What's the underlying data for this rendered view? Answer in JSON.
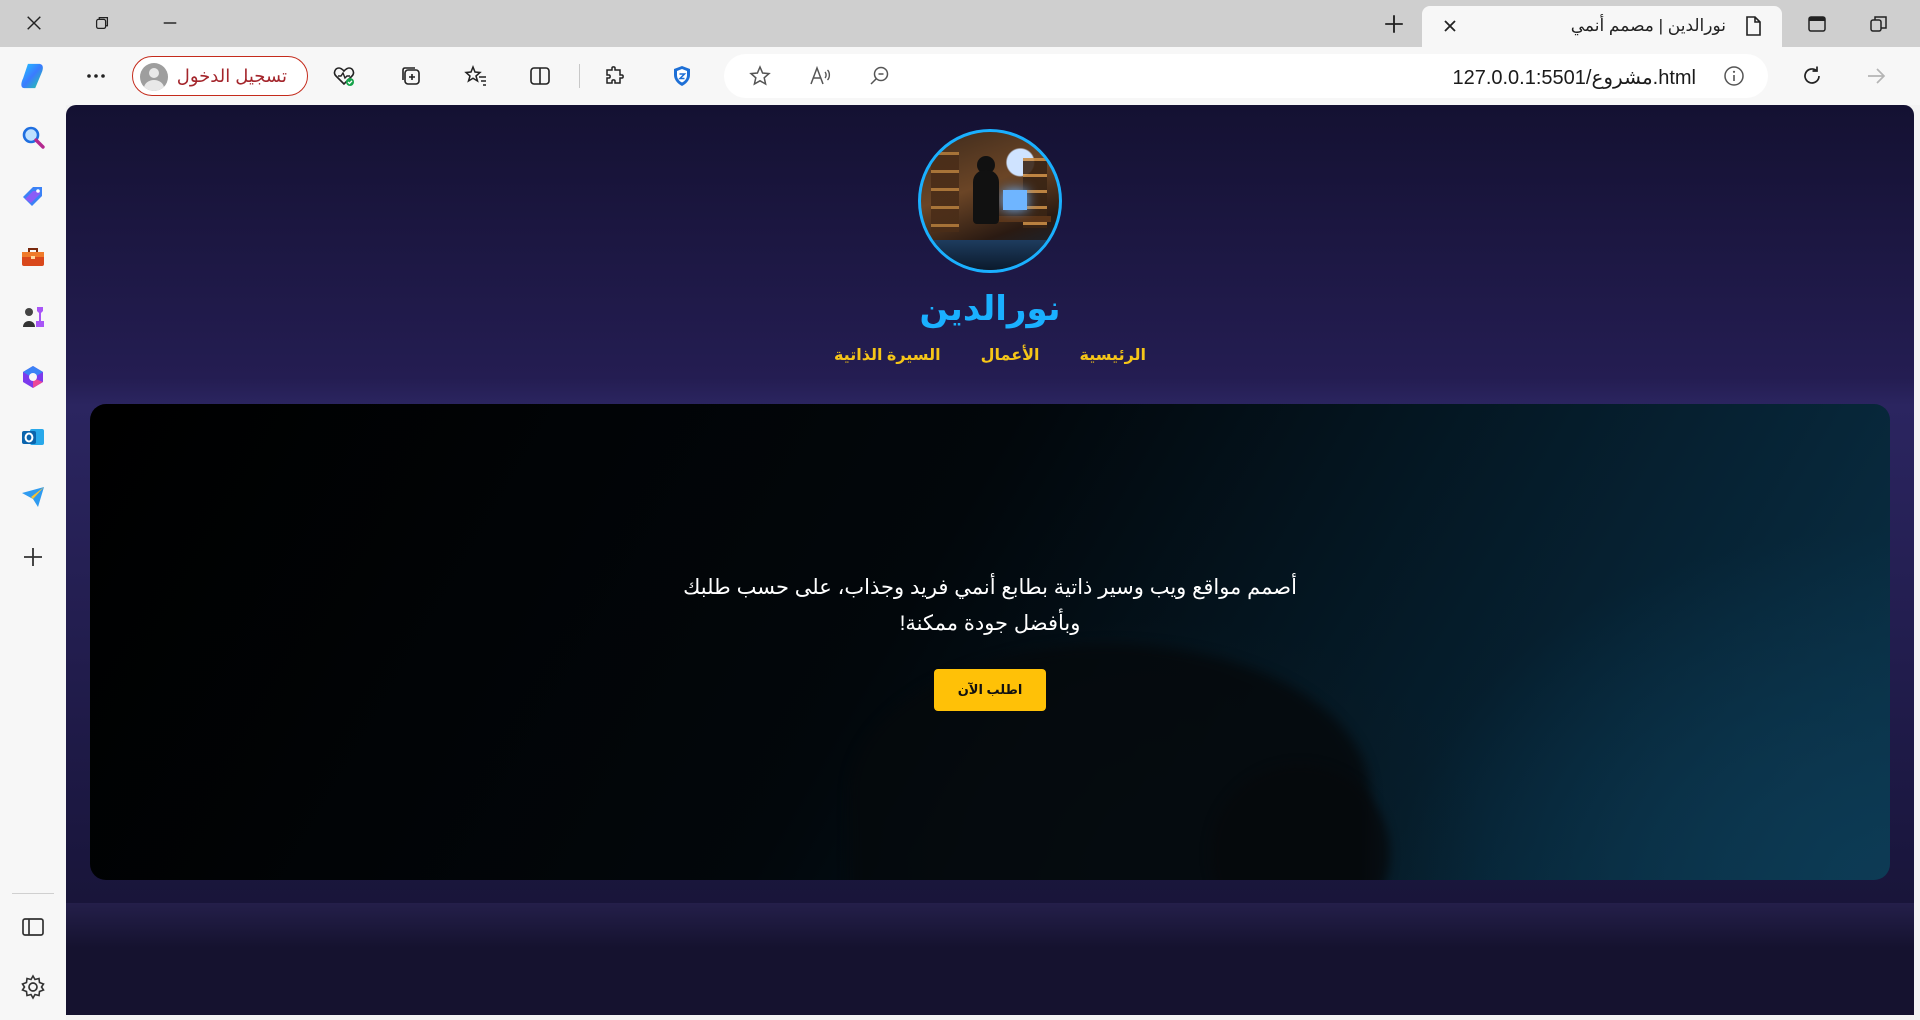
{
  "browser": {
    "tab": {
      "title": "نورالدين | مصمم أنمي",
      "favicon": "page-icon"
    },
    "window_controls": [
      "close-icon",
      "restore-icon",
      "minimize-icon"
    ],
    "signin_label": "تسجيل الدخول",
    "address": {
      "url": "127.0.0.1:5501/مشروع.html"
    },
    "toolbar_icons": [
      "more-icon",
      "health-icon",
      "collections-icon",
      "favorites-icon",
      "split-screen-icon",
      "extensions-icon",
      "shield-icon",
      "star-icon",
      "read-aloud-icon",
      "zoom-icon",
      "info-icon",
      "refresh-icon",
      "forward-icon"
    ],
    "sidebar_icons": [
      "copilot-icon",
      "search-icon",
      "shopping-tag-icon",
      "tools-icon",
      "games-icon",
      "microsoft365-icon",
      "outlook-icon",
      "send-icon",
      "add-icon",
      "sidebar-toggle-icon",
      "settings-icon"
    ]
  },
  "site": {
    "name": "نورالدين",
    "nav": [
      {
        "label": "الرئيسية"
      },
      {
        "label": "الأعمال"
      },
      {
        "label": "السيرة الذاتية"
      }
    ],
    "hero": {
      "text": "أصمم مواقع ويب وسير ذاتية بطابع أنمي فريد وجذاب، على حسب طلبك وبأفضل جودة ممكنة!",
      "button_label": "اطلب الآن"
    },
    "colors": {
      "accent": "#1ab0ff",
      "nav": "#f5c518",
      "button": "#ffc107",
      "background": "#1b1740"
    }
  }
}
